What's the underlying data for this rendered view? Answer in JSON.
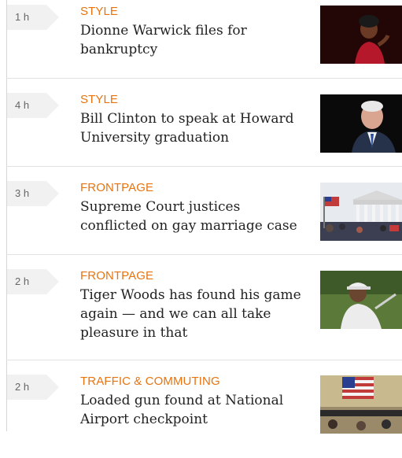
{
  "feed": {
    "items": [
      {
        "time": "1 h",
        "category": "STYLE",
        "headline": "Dionne Warwick files for bankruptcy",
        "image": "dionne-warwick-photo"
      },
      {
        "time": "4 h",
        "category": "STYLE",
        "headline": "Bill Clinton to speak at Howard University graduation",
        "image": "bill-clinton-photo"
      },
      {
        "time": "3 h",
        "category": "FRONTPAGE",
        "headline": "Supreme Court justices conflicted on gay marriage case",
        "image": "supreme-court-photo"
      },
      {
        "time": "2 h",
        "category": "FRONTPAGE",
        "headline": "Tiger Woods has found his game again — and we can all take pleasure in that",
        "image": "tiger-woods-photo"
      },
      {
        "time": "2 h",
        "category": "TRAFFIC & COMMUTING",
        "headline": "Loaded gun found at National Airport checkpoint",
        "image": "airport-checkpoint-photo"
      }
    ]
  },
  "colors": {
    "category": "#e8730f",
    "time_tag_bg": "#f1f1f1",
    "headline": "#222222",
    "divider": "#e2e2e2"
  }
}
